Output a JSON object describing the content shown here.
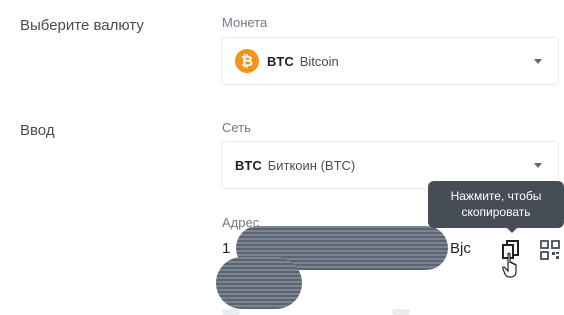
{
  "steps": {
    "currency": "Выберите валюту",
    "deposit": "Ввод"
  },
  "coin_select": {
    "label": "Монета",
    "icon": "bitcoin-icon",
    "icon_glyph": "₿",
    "symbol": "BTC",
    "name": "Bitcoin"
  },
  "network_select": {
    "label": "Сеть",
    "symbol": "BTC",
    "name": "Биткоин (BTC)"
  },
  "address": {
    "label": "Адрес",
    "start": "1",
    "end": "Bjc"
  },
  "tooltip": {
    "line1": "Нажмите, чтобы",
    "line2": "скопировать"
  },
  "colors": {
    "bitcoin": "#f7931a",
    "tooltip_bg": "#474d57",
    "text": "#1e2329",
    "muted": "#707a8a"
  }
}
